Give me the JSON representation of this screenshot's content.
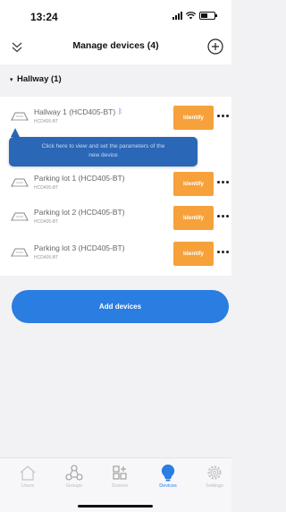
{
  "status_bar": {
    "time": "13:24"
  },
  "nav": {
    "title": "Manage devices (4)",
    "left_icon": "double-chevron-down-icon",
    "right_icon": "plus-circle-icon"
  },
  "group": {
    "caret": "▾",
    "title": "Hallway (1)"
  },
  "devices": [
    {
      "name": "Hallway 1 (HCD405-BT)",
      "sub": "HCD405-BT",
      "bluetooth": true,
      "identify_label": "Identify"
    },
    {
      "name": "Parking lot 1 (HCD405-BT)",
      "sub": "HCD405-BT",
      "bluetooth": false,
      "identify_label": "Identify"
    },
    {
      "name": "Parking lot 2 (HCD405-BT)",
      "sub": "HCD405-BT",
      "bluetooth": false,
      "identify_label": "Identify"
    },
    {
      "name": "Parking lot 3 (HCD405-BT)",
      "sub": "HCD405-BT",
      "bluetooth": false,
      "identify_label": "Identify"
    }
  ],
  "tooltip": {
    "line1": "Click here to view and set the parameters of the",
    "line2": "new device"
  },
  "add_button": {
    "label": "Add devices"
  },
  "tabs": [
    {
      "label": "Users",
      "icon": "home-icon",
      "active": false
    },
    {
      "label": "Groups",
      "icon": "groups-icon",
      "active": false
    },
    {
      "label": "Scenes",
      "icon": "scenes-icon",
      "active": false
    },
    {
      "label": "Devices",
      "icon": "bulb-icon",
      "active": true
    },
    {
      "label": "Settings",
      "icon": "gear-icon",
      "active": false
    }
  ],
  "colors": {
    "accent": "#2a7de1",
    "identify": "#f7a13b",
    "tooltip": "#2a67b6"
  }
}
